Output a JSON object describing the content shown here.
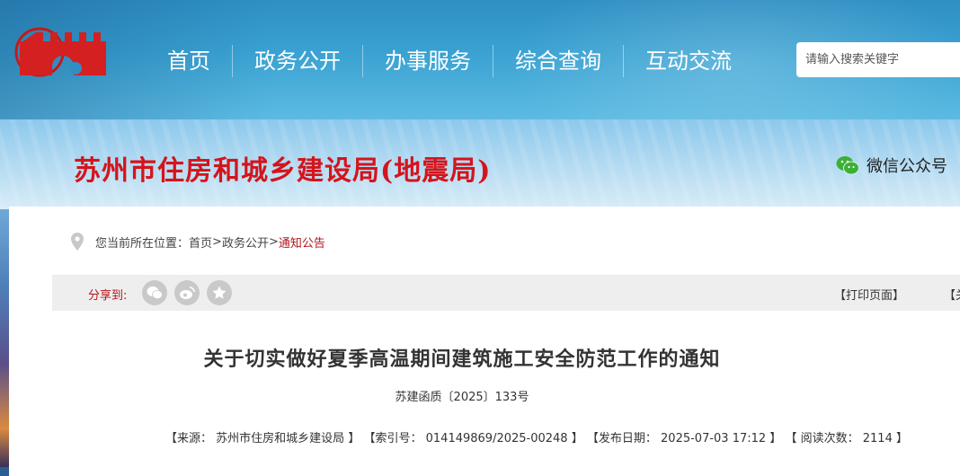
{
  "nav": {
    "items": [
      "首页",
      "政务公开",
      "办事服务",
      "综合查询",
      "互动交流"
    ]
  },
  "search": {
    "placeholder": "请输入搜索关键字"
  },
  "banner": {
    "site_title": "苏州市住房和城乡建设局(地震局)",
    "wechat_label": "微信公众号"
  },
  "breadcrumb": {
    "prefix": "您当前所在位置：",
    "home": "首页",
    "sep1": ">",
    "section": "政务公开",
    "sep2": ">",
    "current": "通知公告"
  },
  "share": {
    "label": "分享到:",
    "icons": [
      "wechat-icon",
      "weibo-icon",
      "favorite-icon"
    ],
    "print": "【打印页面】",
    "close": "【关"
  },
  "article": {
    "title": "关于切实做好夏季高温期间建筑施工安全防范工作的通知",
    "doc_no": "苏建函质〔2025〕133号",
    "meta": {
      "source_label": "【来源：",
      "source": "苏州市住房和城乡建设局",
      "source_end": "】",
      "index_label": "【索引号：",
      "index": "014149869/2025-00248",
      "index_end": "】",
      "date_label": "【发布日期：",
      "date": "2025-07-03 17:12",
      "date_end": "】",
      "views_label": "【 阅读次数：",
      "views": "2114",
      "views_end": "】"
    }
  },
  "colors": {
    "accent_red": "#b3141b",
    "title_red": "#d4141c",
    "nav_blue": "#3aa2d2"
  }
}
